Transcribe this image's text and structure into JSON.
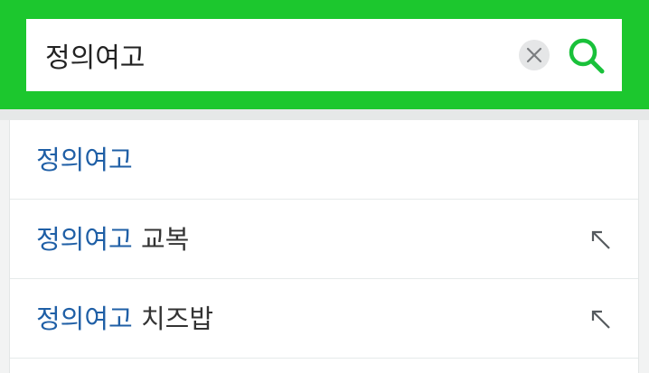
{
  "search": {
    "value": "정의여고",
    "clear_icon": "close-icon",
    "search_icon": "search-icon"
  },
  "colors": {
    "header_green": "#1cc72e",
    "search_icon_green": "#19c13a",
    "highlight_blue": "#1f5fa6",
    "text_dark": "#333333"
  },
  "suggestions": [
    {
      "match": "정의여고",
      "rest": "",
      "has_fill_arrow": false
    },
    {
      "match": "정의여고",
      "rest": " 교복",
      "has_fill_arrow": true,
      "icon": "arrow-up-left-icon"
    },
    {
      "match": "정의여고",
      "rest": " 치즈밥",
      "has_fill_arrow": true,
      "icon": "arrow-up-left-icon"
    }
  ]
}
